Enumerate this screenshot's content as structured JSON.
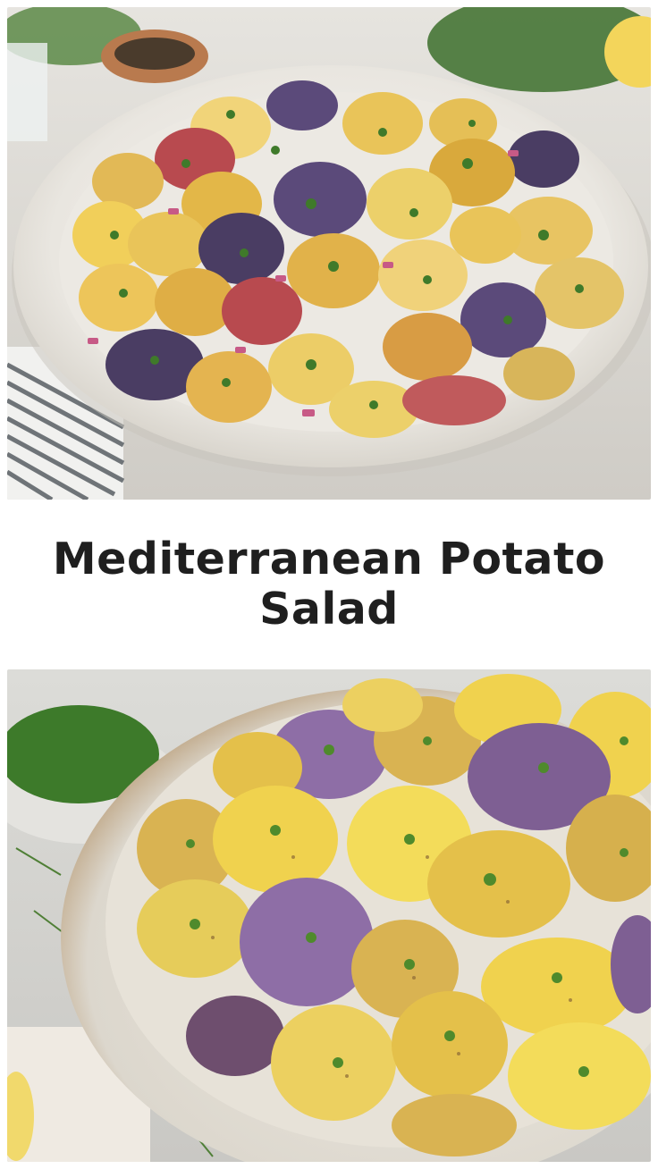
{
  "title": "Mediterranean Potato Salad",
  "images": {
    "top": {
      "subject": "white bowl of potato salad",
      "potato_colors": [
        "#e9c459",
        "#d9a93c",
        "#b84a4f",
        "#5b4a7a",
        "#f1d479"
      ],
      "herb_color": "#3f7a2a",
      "onion_color": "#c75a86"
    },
    "bottom": {
      "subject": "cream bowl of potato salad with dill",
      "potato_colors": [
        "#f0d24e",
        "#e4c04a",
        "#8e6ea6",
        "#d9b352"
      ],
      "herb_color": "#4f8a2c"
    }
  }
}
